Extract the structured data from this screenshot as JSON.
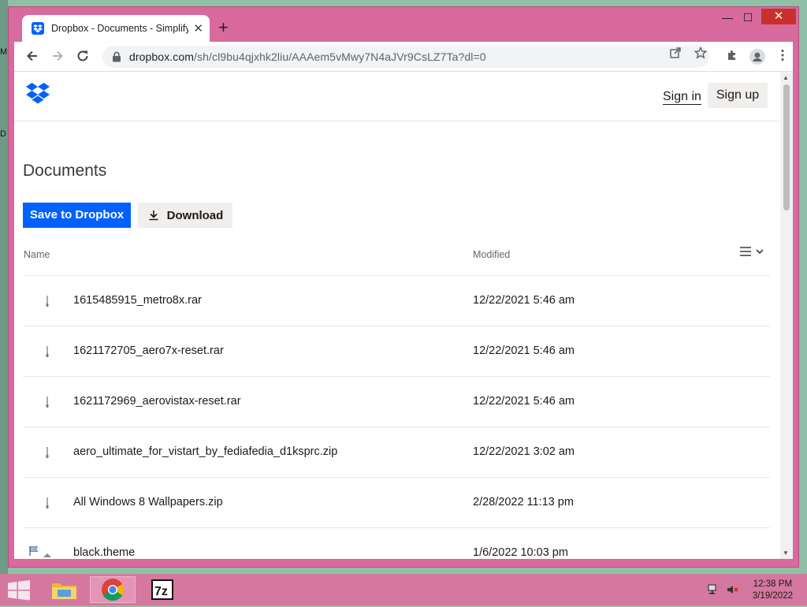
{
  "desktop": {
    "edge_labels": [
      "M",
      "D"
    ]
  },
  "browser": {
    "tab_title": "Dropbox - Documents - Simplify",
    "tab_close": "✕",
    "new_tab": "+",
    "window_buttons": {
      "minimize": "—",
      "maximize": "☐",
      "close": "✕"
    },
    "url_host": "dropbox.com",
    "url_path": "/sh/cl9bu4qjxhk2liu/AAAem5vMwy7N4aJVr9CsLZ7Ta?dl=0"
  },
  "page": {
    "header": {
      "sign_in": "Sign in",
      "sign_up": "Sign up"
    },
    "title": "Documents",
    "save_button": "Save to Dropbox",
    "download_button": "Download",
    "columns": {
      "name": "Name",
      "modified": "Modified"
    },
    "files": [
      {
        "name": "1615485915_metro8x.rar",
        "modified": "12/22/2021 5:46 am",
        "icon": "archive-file-icon"
      },
      {
        "name": "1621172705_aero7x-reset.rar",
        "modified": "12/22/2021 5:46 am",
        "icon": "archive-file-icon"
      },
      {
        "name": "1621172969_aerovistax-reset.rar",
        "modified": "12/22/2021 5:46 am",
        "icon": "archive-file-icon"
      },
      {
        "name": "aero_ultimate_for_vistart_by_fediafedia_d1ksprc.zip",
        "modified": "12/22/2021 3:02 am",
        "icon": "archive-file-icon"
      },
      {
        "name": "All Windows 8 Wallpapers.zip",
        "modified": "2/28/2022 11:13 pm",
        "icon": "archive-file-icon"
      },
      {
        "name": "black.theme",
        "modified": "1/6/2022 10:03 pm",
        "icon": "theme-file-icon"
      }
    ]
  },
  "taskbar": {
    "time": "12:38 PM",
    "date": "3/19/2022"
  },
  "colors": {
    "window_frame": "#d86a9e",
    "taskbar": "#d4789f",
    "dropbox_blue": "#0061fe"
  }
}
